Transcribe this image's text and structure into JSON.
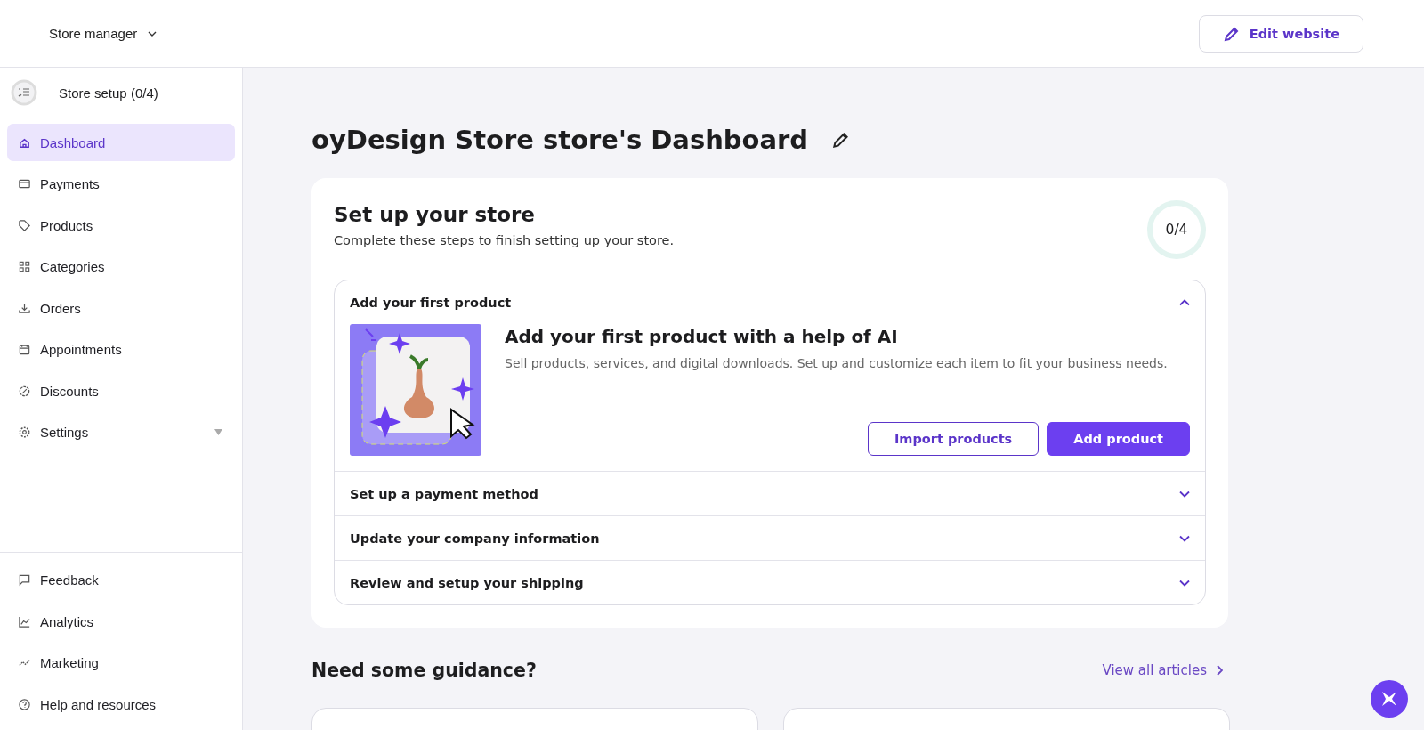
{
  "header": {
    "store_menu": "Store manager",
    "edit_button": "Edit website"
  },
  "sidebar": {
    "setup": {
      "label": "Store setup (0/4)",
      "level": 0
    },
    "items": [
      {
        "label": "Dashboard",
        "selected": true,
        "has_submenu": false
      },
      {
        "label": "Payments",
        "selected": false,
        "has_submenu": false
      },
      {
        "label": "Products",
        "selected": false,
        "has_submenu": false
      },
      {
        "label": "Categories",
        "selected": false,
        "has_submenu": false
      },
      {
        "label": "Orders",
        "selected": false,
        "has_submenu": false
      },
      {
        "label": "Appointments",
        "selected": false,
        "has_submenu": false
      },
      {
        "label": "Discounts",
        "selected": false,
        "has_submenu": false
      },
      {
        "label": "Settings",
        "selected": false,
        "has_submenu": true
      }
    ],
    "bottom_items": [
      {
        "label": "Feedback"
      },
      {
        "label": "Analytics"
      },
      {
        "label": "Marketing"
      },
      {
        "label": "Help and resources"
      }
    ]
  },
  "page_title": "oyDesign Store store's Dashboard",
  "setup_card": {
    "title": "Set up your store",
    "subtitle": "Complete these steps to finish setting up your store.",
    "progress": {
      "text": "0/4",
      "level": 0
    },
    "steps": [
      {
        "title": "Add your first product",
        "expanded": true,
        "heading": "Add your first product with a help of AI",
        "description": "Sell products, services, and digital downloads. Set up and customize each item to fit your business needs.",
        "secondary_button": "Import products",
        "primary_button": "Add product"
      },
      {
        "title": "Set up a payment method",
        "expanded": false
      },
      {
        "title": "Update your company information",
        "expanded": false
      },
      {
        "title": "Review and setup your shipping",
        "expanded": false
      }
    ]
  },
  "guidance": {
    "title": "Need some guidance?",
    "link": "View all articles"
  }
}
